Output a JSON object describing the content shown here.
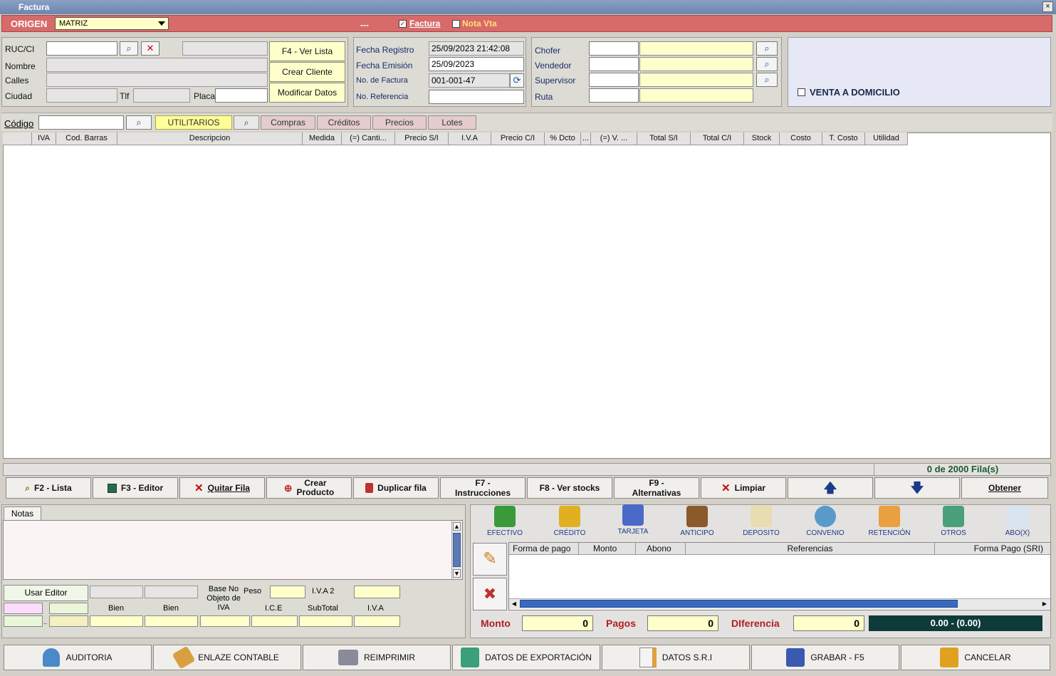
{
  "window": {
    "title": "Factura",
    "close": "×"
  },
  "origin": {
    "label": "ORIGEN",
    "select_value": "MATRIZ",
    "dots": "---",
    "factura_label": "Factura",
    "factura_checked": "✓",
    "nota_label": "Nota Vta"
  },
  "client": {
    "ruc_label": "RUC/CI",
    "nombre_label": "Nombre",
    "calles_label": "Calles",
    "ciudad_label": "Ciudad",
    "tlf_label": "Tlf",
    "placa_label": "Placa",
    "ver_lista": "F4 - Ver Lista",
    "crear_cliente": "Crear Cliente",
    "modificar_datos": "Modificar Datos"
  },
  "invoice": {
    "fecha_registro_label": "Fecha Registro",
    "fecha_registro": "25/09/2023 21:42:08",
    "fecha_emision_label": "Fecha Emisión",
    "fecha_emision": "25/09/2023",
    "no_factura_label": "No. de Factura",
    "no_factura": "001-001-47",
    "no_referencia_label": "No. Referencia"
  },
  "staff": {
    "chofer": "Chofer",
    "vendedor": "Vendedor",
    "supervisor": "Supervisor",
    "ruta": "Ruta"
  },
  "domicilio": {
    "label": "VENTA A DOMICILIO"
  },
  "product_bar": {
    "codigo_label": "Código",
    "tabs": [
      "UTILITARIOS",
      "Compras",
      "Créditos",
      "Precios",
      "Lotes"
    ]
  },
  "grid": {
    "columns": [
      "IVA",
      "Cod. Barras",
      "Descripcion",
      "Medida",
      "(=) Canti...",
      "Precio S/I",
      "I.V.A",
      "Precio C/I",
      "% Dcto",
      "...",
      "(=) V. ...",
      "Total S/I",
      "Total C/I",
      "Stock",
      "Costo",
      "T. Costo",
      "Utilidad"
    ],
    "rows_status": "0 de 2000  Fila(s)"
  },
  "fn_buttons": {
    "f2": "F2 - Lista",
    "f3": "F3 - Editor",
    "quitar": "Quitar Fila",
    "crear_l1": "Crear",
    "crear_l2": "Producto",
    "duplicar": "Duplicar fila",
    "f7_l1": "F7 -",
    "f7_l2": "Instrucciones",
    "f8": "F8 - Ver stocks",
    "f9_l1": "F9 -",
    "f9_l2": "Alternativas",
    "limpiar": "Limpiar",
    "obtener": "Obtener"
  },
  "notes": {
    "tab": "Notas",
    "usar_editor": "Usar Editor",
    "base_no_objeto": "Base No Objeto de IVA",
    "peso": "Peso",
    "iva2": "I.V.A 2",
    "bien1": "Bien",
    "bien2": "Bien",
    "ice": "I.C.E",
    "subtotal": "SubTotal",
    "iva": "I.V.A",
    "small_dots": ".."
  },
  "payments": {
    "methods": [
      "EFECTIVO",
      "CRÉDITO",
      "TARJETA",
      "ANTICIPO",
      "DEPOSITO",
      "CONVENIO",
      "RETENCIÓN",
      "OTROS",
      "ABO(X)"
    ],
    "columns": [
      "Forma de pago",
      "Monto",
      "Abono",
      "Referencias",
      "Forma Pago (SRI)"
    ]
  },
  "totals": {
    "monto_label": "Monto",
    "monto": "0",
    "pagos_label": "Pagos",
    "pagos": "0",
    "diferencia_label": "DIferencia",
    "diferencia": "0",
    "balance": "0.00 - (0.00)"
  },
  "bottom_buttons": [
    "AUDITORIA",
    "ENLAZE CONTABLE",
    "REIMPRIMIR",
    "DATOS DE EXPORTACIÓN",
    "DATOS S.R.I",
    "GRABAR - F5",
    "CANCELAR"
  ],
  "colors": {
    "origin_bar": "#d86a6a",
    "yellow_field": "#ffffcc",
    "balance_bg": "#0f3a3a",
    "total_label": "#b02020"
  }
}
